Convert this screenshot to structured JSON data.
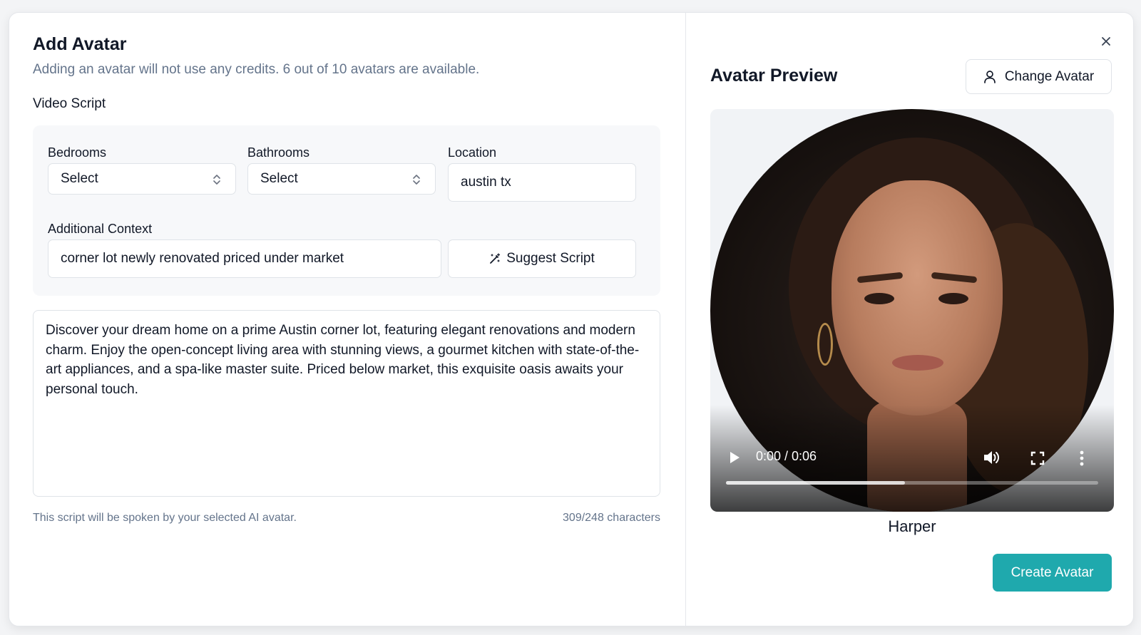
{
  "left": {
    "title": "Add Avatar",
    "subtitle": "Adding an avatar will not use any credits. 6 out of 10 avatars are available.",
    "section_label": "Video Script",
    "fields": {
      "bedrooms": {
        "label": "Bedrooms",
        "value": "Select"
      },
      "bathrooms": {
        "label": "Bathrooms",
        "value": "Select"
      },
      "location": {
        "label": "Location",
        "value": "austin tx"
      },
      "context": {
        "label": "Additional Context",
        "value": "corner lot newly renovated priced under market"
      }
    },
    "suggest_label": "Suggest Script",
    "script_text": "Discover your dream home on a prime Austin corner lot, featuring elegant renovations and modern charm. Enjoy the open-concept living area with stunning views, a gourmet kitchen with state-of-the-art appliances, and a spa-like master suite. Priced below market, this exquisite oasis awaits your personal touch.",
    "helper_text": "This script will be spoken by your selected AI avatar.",
    "char_counter": "309/248 characters"
  },
  "right": {
    "title": "Avatar Preview",
    "change_label": "Change Avatar",
    "video": {
      "time": "0:00 / 0:06",
      "progress_fraction": 0.48
    },
    "avatar_name": "Harper",
    "create_label": "Create Avatar"
  },
  "colors": {
    "accent": "#1fa9ad",
    "muted_text": "#64748b",
    "border": "#dfe3e8"
  },
  "icons": {
    "close": "close-icon",
    "change": "user-icon",
    "suggest": "magic-wand-icon",
    "select_chevron": "chevron-up-down-icon",
    "play": "play-icon",
    "volume": "volume-icon",
    "fullscreen": "fullscreen-icon",
    "more": "more-vertical-icon"
  }
}
